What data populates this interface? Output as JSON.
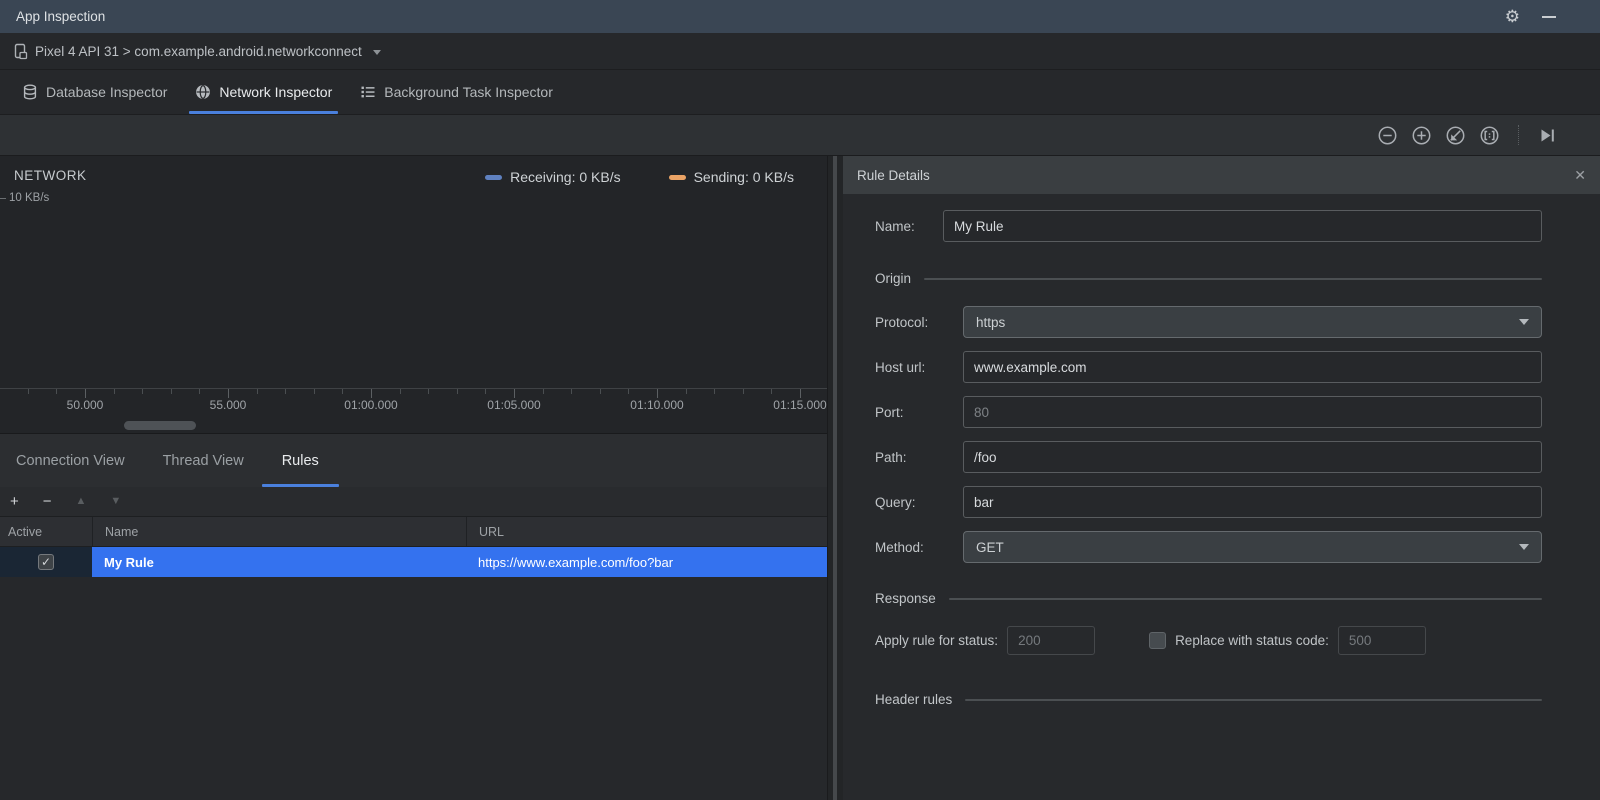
{
  "titlebar": {
    "title": "App Inspection"
  },
  "icons": {
    "gear": "⚙",
    "check": "✓",
    "close": "✕",
    "add": "+",
    "remove": "−",
    "move_up": "▲",
    "move_down": "▼"
  },
  "device_bar": {
    "selection": "Pixel 4 API 31 > com.example.android.networkconnect"
  },
  "inspector_tabs": {
    "tabs": [
      {
        "label": "Database Inspector",
        "active": false
      },
      {
        "label": "Network Inspector",
        "active": true
      },
      {
        "label": "Background Task Inspector",
        "active": false
      }
    ]
  },
  "network_chart": {
    "type": "line",
    "title": "NETWORK",
    "y_axis_tick": "10 KB/s",
    "legend_position": "top-right",
    "grid": false,
    "legend": [
      {
        "name": "receiving",
        "label": "Receiving: 0 KB/s",
        "color": "#5f81c0",
        "current_value": "0 KB/s"
      },
      {
        "name": "sending",
        "label": "Sending: 0 KB/s",
        "color": "#eaa365",
        "current_value": "0 KB/s"
      }
    ],
    "series": [
      {
        "name": "Receiving",
        "values": []
      },
      {
        "name": "Sending",
        "values": []
      }
    ],
    "x_ticks": [
      "50.000",
      "55.000",
      "01:00.000",
      "01:05.000",
      "01:10.000",
      "01:15.000"
    ]
  },
  "view_tabs": {
    "tabs": [
      {
        "label": "Connection View",
        "active": false
      },
      {
        "label": "Thread View",
        "active": false
      },
      {
        "label": "Rules",
        "active": true
      }
    ]
  },
  "rules_table": {
    "columns": [
      "Active",
      "Name",
      "URL"
    ],
    "rows": [
      {
        "active": true,
        "name": "My Rule",
        "url": "https://www.example.com/foo?bar",
        "selected": true
      }
    ]
  },
  "rule_details": {
    "title": "Rule Details",
    "sections": {
      "origin": "Origin",
      "response": "Response",
      "header_rules": "Header rules"
    },
    "fields": {
      "name": {
        "label": "Name:",
        "value": "My Rule"
      },
      "protocol": {
        "label": "Protocol:",
        "value": "https"
      },
      "host": {
        "label": "Host url:",
        "value": "www.example.com"
      },
      "port": {
        "label": "Port:",
        "placeholder": "80"
      },
      "path": {
        "label": "Path:",
        "value": "/foo"
      },
      "query": {
        "label": "Query:",
        "value": "bar"
      },
      "method": {
        "label": "Method:",
        "value": "GET"
      }
    },
    "response": {
      "apply_label": "Apply rule for status:",
      "apply_placeholder": "200",
      "replace_label": "Replace with status code:",
      "replace_placeholder": "500",
      "replace_checked": false
    }
  }
}
